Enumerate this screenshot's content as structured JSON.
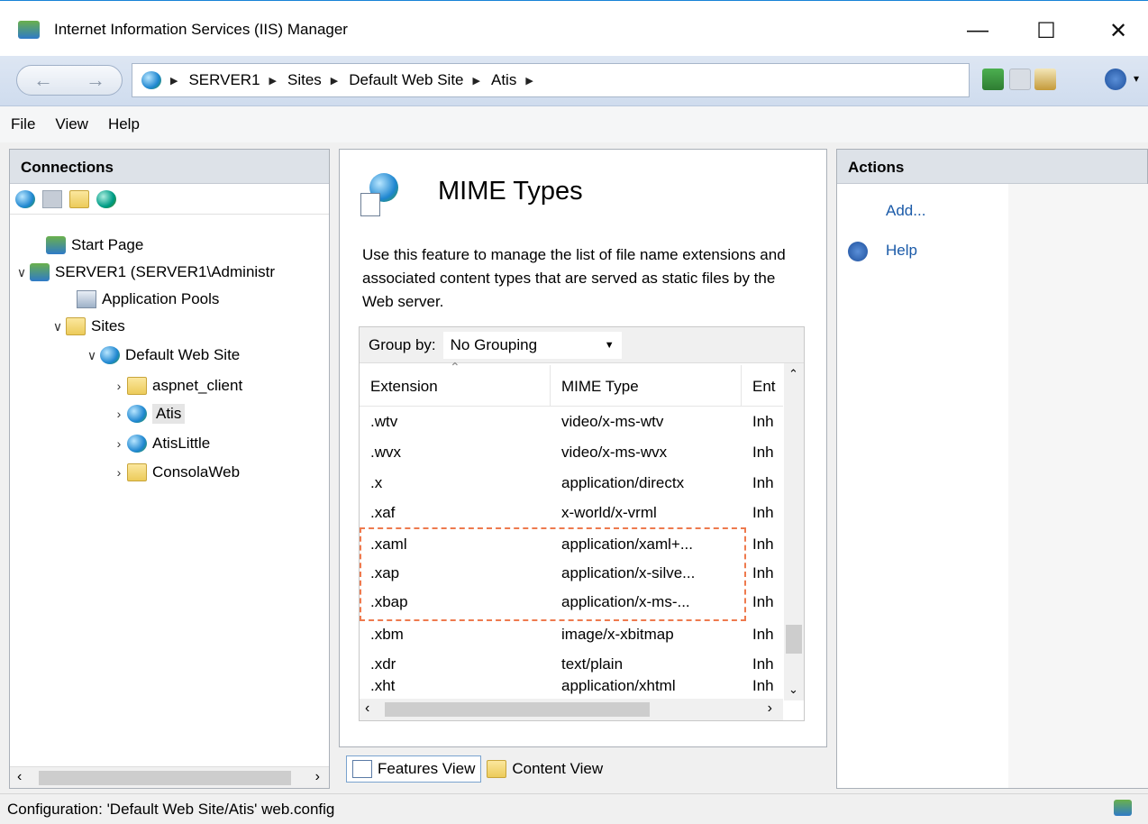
{
  "window": {
    "title": "Internet Information Services (IIS) Manager"
  },
  "address": {
    "crumbs": [
      "SERVER1",
      "Sites",
      "Default Web Site",
      "Atis"
    ]
  },
  "menu": {
    "items": [
      "File",
      "View",
      "Help"
    ]
  },
  "connections": {
    "header": "Connections",
    "tree": [
      {
        "label": "Start Page"
      },
      {
        "label": "SERVER1 (SERVER1\\Administr"
      },
      {
        "label": "Application Pools"
      },
      {
        "label": "Sites"
      },
      {
        "label": "Default Web Site"
      },
      {
        "label": "aspnet_client"
      },
      {
        "label": "Atis"
      },
      {
        "label": "AtisLittle"
      },
      {
        "label": "ConsolaWeb"
      }
    ]
  },
  "feature": {
    "title": "MIME Types",
    "description": "Use this feature to manage the list of file name extensions and associated content types that are served as static files by the Web server.",
    "group_label": "Group by:",
    "group_value": "No Grouping",
    "columns": [
      "Extension",
      "MIME Type",
      "Ent"
    ],
    "rows": [
      {
        "ext": ".wtv",
        "mime": "video/x-ms-wtv",
        "entry": "Inh"
      },
      {
        "ext": ".wvx",
        "mime": "video/x-ms-wvx",
        "entry": "Inh"
      },
      {
        "ext": ".x",
        "mime": "application/directx",
        "entry": "Inh"
      },
      {
        "ext": ".xaf",
        "mime": "x-world/x-vrml",
        "entry": "Inh"
      },
      {
        "ext": ".xaml",
        "mime": "application/xaml+...",
        "entry": "Inh"
      },
      {
        "ext": ".xap",
        "mime": "application/x-silve...",
        "entry": "Inh"
      },
      {
        "ext": ".xbap",
        "mime": "application/x-ms-...",
        "entry": "Inh"
      },
      {
        "ext": ".xbm",
        "mime": "image/x-xbitmap",
        "entry": "Inh"
      },
      {
        "ext": ".xdr",
        "mime": "text/plain",
        "entry": "Inh"
      },
      {
        "ext": ".xht",
        "mime": "application/xhtml",
        "entry": "Inh"
      }
    ]
  },
  "views": {
    "features": "Features View",
    "content": "Content View"
  },
  "actions": {
    "header": "Actions",
    "add": "Add...",
    "help": "Help"
  },
  "status": {
    "text": "Configuration: 'Default Web Site/Atis' web.config"
  }
}
